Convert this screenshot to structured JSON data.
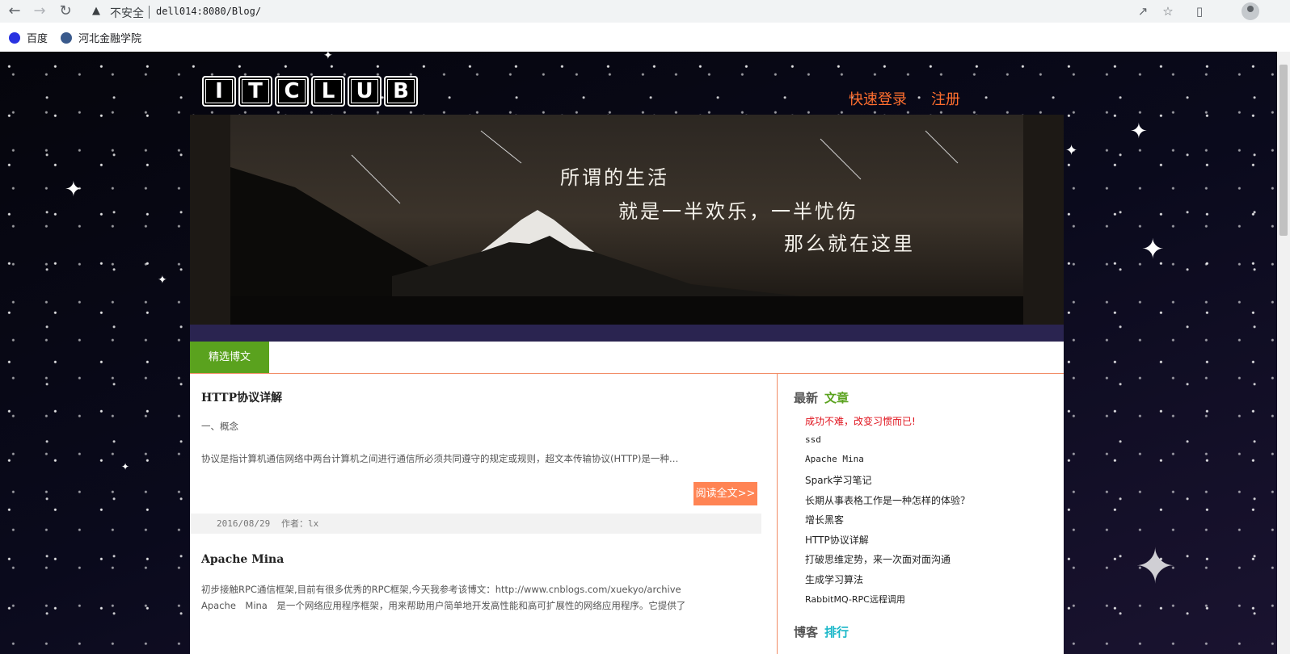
{
  "browser": {
    "insecure_label": "不安全",
    "url": "dell014:8080/Blog/",
    "bookmarks": [
      {
        "label": "百度",
        "icon": "baidu-paw-icon"
      },
      {
        "label": "河北金融学院",
        "icon": "school-seal-icon"
      }
    ]
  },
  "site": {
    "logo_letters": [
      "I",
      "T",
      "C",
      "L",
      "U",
      "B"
    ],
    "login_link": "快速登录",
    "register_link": "注册",
    "banner_lines": [
      "所谓的生活",
      "就是一半欢乐，一半忧伤",
      "那么就在这里"
    ],
    "tab_featured": "精选博文"
  },
  "posts": [
    {
      "title": "HTTP协议详解",
      "lines": [
        "一、概念",
        "协议是指计算机通信网络中两台计算机之间进行通信所必须共同遵守的规定或规则，超文本传输协议(HTTP)是一种通信协议"
      ],
      "read_more": "阅读全文>>",
      "date": "2016/08/29",
      "author": "作者：lx"
    },
    {
      "title": "Apache Mina",
      "lines": [
        "初步接触RPC通信框架,目前有很多优秀的RPC框架,今天我参考该博文：http://www.cnblogs.com/xuekyo/archive",
        "Apache　Mina　是一个网络应用程序框架，用来帮助用户简单地开发高性能和高可扩展性的网络应用程序。它提供了"
      ]
    }
  ],
  "sidebar": {
    "latest_heading": "最新",
    "latest_accent": "文章",
    "articles": [
      "成功不难，改变习惯而已!",
      "ssd",
      "Apache Mina",
      "Spark学习笔记",
      "长期从事表格工作是一种怎样的体验？",
      "增长黑客",
      "HTTP协议详解",
      "打破思维定势，来一次面对面沟通",
      "生成学习算法",
      "RabbitMQ-RPC远程调用"
    ],
    "ranking_heading": "博客",
    "ranking_accent": "排行"
  },
  "colors": {
    "accent_orange": "#ff6e2e",
    "tab_green": "#5aa21e",
    "highlight_red": "#e0141e",
    "ranking_cyan": "#19b7c8"
  }
}
